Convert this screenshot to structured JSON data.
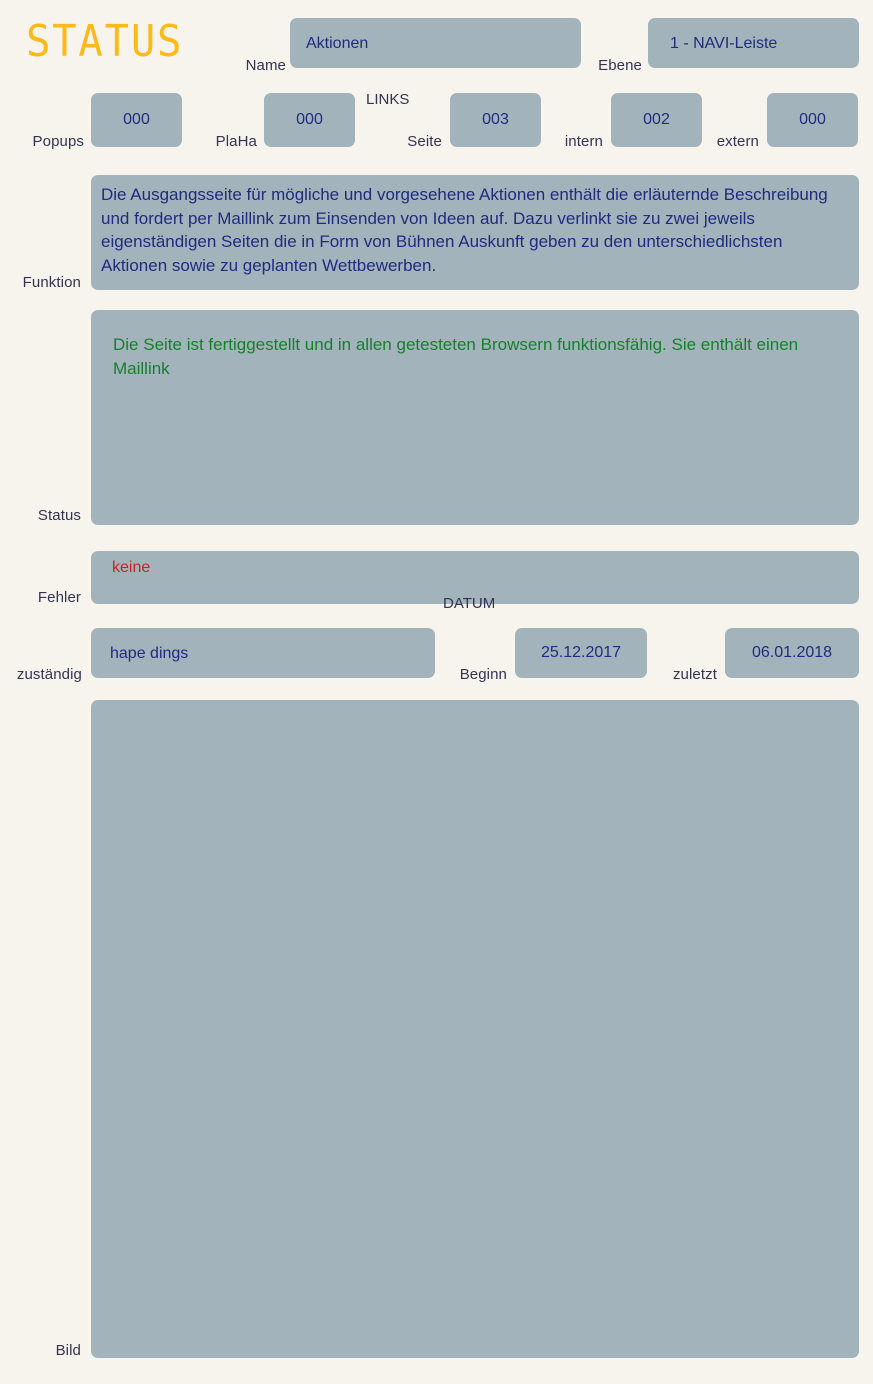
{
  "header": {
    "title": "STATUS",
    "name_label": "Name",
    "name_value": "Aktionen",
    "ebene_label": "Ebene",
    "ebene_value": "1 - NAVI-Leiste"
  },
  "counters": {
    "links_group_label": "LINKS",
    "popups_label": "Popups",
    "popups_value": "000",
    "plaha_label": "PlaHa",
    "plaha_value": "000",
    "seite_label": "Seite",
    "seite_value": "003",
    "intern_label": "intern",
    "intern_value": "002",
    "extern_label": "extern",
    "extern_value": "000"
  },
  "funktion": {
    "label": "Funktion",
    "text": "Die Ausgangsseite für mögliche und vorgesehene Aktionen enthält die erläuternde Beschreibung und fordert per Maillink zum Einsenden von Ideen auf. Dazu verlinkt sie zu zwei jeweils eigenständigen Seiten die in Form von Bühnen Auskunft geben zu den unterschiedlichsten Aktionen sowie zu geplanten Wettbewerben."
  },
  "status": {
    "label": "Status",
    "text": "Die Seite ist fertiggestellt und in allen getesteten Browsern funktionsfähig. Sie enthält einen Maillink"
  },
  "fehler": {
    "label": "Fehler",
    "text": "keine"
  },
  "zustaendig": {
    "label": "zuständig",
    "value": "hape dings"
  },
  "datum": {
    "group_label": "DATUM",
    "beginn_label": "Beginn",
    "beginn_value": "25.12.2017",
    "zuletzt_label": "zuletzt",
    "zuletzt_value": "06.01.2018"
  },
  "bild": {
    "label": "Bild"
  },
  "colors": {
    "background": "#f7f4ee",
    "field": "#a3b3bc",
    "title": "#fbba17",
    "value_text": "#1f2b80",
    "label_text": "#343350",
    "status_ok": "#15802b",
    "error": "#d02020"
  }
}
